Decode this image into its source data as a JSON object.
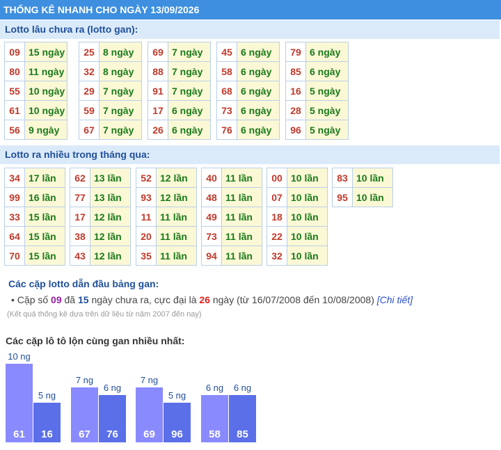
{
  "header": {
    "title": "THỐNG KÊ NHANH CHO NGÀY 13/09/2026"
  },
  "lotto_gan": {
    "title": "Lotto lâu chưa ra (lotto gan):",
    "groups": [
      [
        [
          "09",
          "15 ngày"
        ],
        [
          "80",
          "11 ngày"
        ],
        [
          "55",
          "10 ngày"
        ],
        [
          "61",
          "10 ngày"
        ],
        [
          "56",
          "9 ngày"
        ]
      ],
      [
        [
          "25",
          "8 ngày"
        ],
        [
          "32",
          "8 ngày"
        ],
        [
          "29",
          "7 ngày"
        ],
        [
          "59",
          "7 ngày"
        ],
        [
          "67",
          "7 ngày"
        ]
      ],
      [
        [
          "69",
          "7 ngày"
        ],
        [
          "88",
          "7 ngày"
        ],
        [
          "91",
          "7 ngày"
        ],
        [
          "17",
          "6 ngày"
        ],
        [
          "26",
          "6 ngày"
        ]
      ],
      [
        [
          "45",
          "6 ngày"
        ],
        [
          "58",
          "6 ngày"
        ],
        [
          "68",
          "6 ngày"
        ],
        [
          "73",
          "6 ngày"
        ],
        [
          "76",
          "6 ngày"
        ]
      ],
      [
        [
          "79",
          "6 ngày"
        ],
        [
          "85",
          "6 ngày"
        ],
        [
          "16",
          "5 ngày"
        ],
        [
          "28",
          "5 ngày"
        ],
        [
          "96",
          "5 ngày"
        ]
      ]
    ]
  },
  "lotto_nhieu": {
    "title": "Lotto ra nhiều trong tháng qua:",
    "groups": [
      [
        [
          "34",
          "17 lần"
        ],
        [
          "99",
          "16 lần"
        ],
        [
          "33",
          "15 lần"
        ],
        [
          "64",
          "15 lần"
        ],
        [
          "70",
          "15 lần"
        ]
      ],
      [
        [
          "62",
          "13 lần"
        ],
        [
          "77",
          "13 lần"
        ],
        [
          "17",
          "12 lần"
        ],
        [
          "38",
          "12 lần"
        ],
        [
          "43",
          "12 lần"
        ]
      ],
      [
        [
          "52",
          "12 lần"
        ],
        [
          "93",
          "12 lần"
        ],
        [
          "11",
          "11 lần"
        ],
        [
          "20",
          "11 lần"
        ],
        [
          "35",
          "11 lần"
        ]
      ],
      [
        [
          "40",
          "11 lần"
        ],
        [
          "48",
          "11 lần"
        ],
        [
          "49",
          "11 lần"
        ],
        [
          "73",
          "11 lần"
        ],
        [
          "94",
          "11 lần"
        ]
      ],
      [
        [
          "00",
          "10 lần"
        ],
        [
          "07",
          "10 lần"
        ],
        [
          "18",
          "10 lần"
        ],
        [
          "22",
          "10 lần"
        ],
        [
          "32",
          "10 lần"
        ]
      ],
      [
        [
          "83",
          "10 lần"
        ],
        [
          "95",
          "10 lần"
        ]
      ]
    ]
  },
  "pairs": {
    "title": "Các cặp lotto dẫn đầu bảng gan:",
    "t1": "Cặp số ",
    "num": "09",
    "t2": " đã ",
    "days": "15",
    "t3": " ngày chưa ra, cực đại là ",
    "max": "26",
    "t4": " ngày (từ 16/07/2008 đến 10/08/2008) ",
    "link": "[Chi tiết]",
    "note": "(Kết quả thống kê dựa trên dữ liệu từ năm 2007 đến nay)"
  },
  "lon": {
    "title": "Các cặp lô tô lộn cùng gan nhiều nhất:",
    "bars": [
      {
        "num": "61",
        "days": 10,
        "label": "10 ng",
        "color": "#8a8aff"
      },
      {
        "num": "16",
        "days": 5,
        "label": "5 ng",
        "color": "#5a6fe8"
      },
      {
        "num": "67",
        "days": 7,
        "label": "7 ng",
        "color": "#8a8aff"
      },
      {
        "num": "76",
        "days": 6,
        "label": "6 ng",
        "color": "#5a6fe8"
      },
      {
        "num": "69",
        "days": 7,
        "label": "7 ng",
        "color": "#8a8aff"
      },
      {
        "num": "96",
        "days": 5,
        "label": "5 ng",
        "color": "#5a6fe8"
      },
      {
        "num": "58",
        "days": 6,
        "label": "6 ng",
        "color": "#8a8aff"
      },
      {
        "num": "85",
        "days": 6,
        "label": "6 ng",
        "color": "#5a6fe8"
      }
    ]
  }
}
